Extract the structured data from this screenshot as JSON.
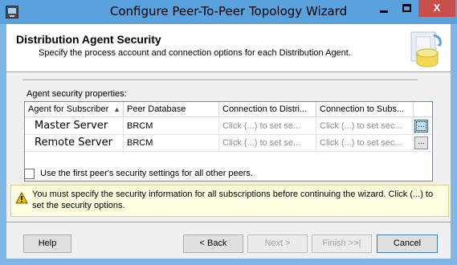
{
  "window": {
    "title": "Configure Peer-To-Peer Topology Wizard",
    "minimize_icon": "minimize-icon",
    "maximize_icon": "maximize-icon",
    "close_label": "X",
    "accent": "#5aa2de",
    "close_color": "#c7504a"
  },
  "header": {
    "title": "Distribution Agent Security",
    "subtitle": "Specify the process account and connection options for each Distribution Agent.",
    "art_icon": "database-security-icon"
  },
  "grid": {
    "group_label": "Agent security properties:",
    "columns": [
      "Agent for Subscriber",
      "Peer Database",
      "Connection to Distri...",
      "Connection to Subs..."
    ],
    "sort_indicator": "▲",
    "rows": [
      {
        "subscriber": "Master Server",
        "database": "BRCM",
        "distributor": "Click (...) to set se...",
        "subscriber_conn": "Click (...) to set sec...",
        "button": "..."
      },
      {
        "subscriber": "Remote Server",
        "database": "BRCM",
        "distributor": "Click (...) to set se...",
        "subscriber_conn": "Click (...) to set sec...",
        "button": "..."
      }
    ]
  },
  "checkbox": {
    "label": "Use the first peer's security settings for all other peers.",
    "checked": false
  },
  "warning": {
    "icon": "warning-icon",
    "text": "You must specify the security information for all subscriptions before continuing the wizard. Click (...) to set the security options."
  },
  "buttons": {
    "help": "Help",
    "back": "< Back",
    "next": "Next >",
    "finish": "Finish >>|",
    "cancel": "Cancel"
  }
}
